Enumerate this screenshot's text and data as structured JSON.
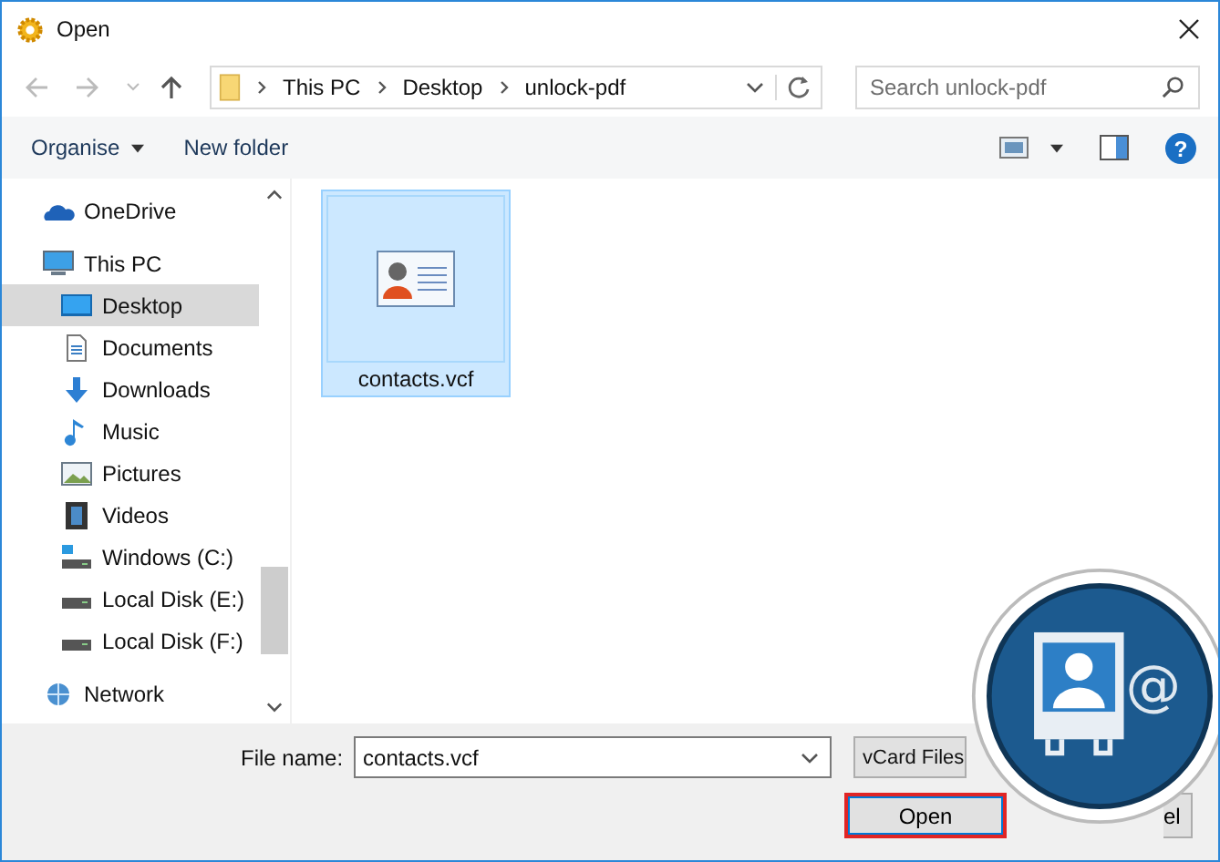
{
  "window": {
    "title": "Open"
  },
  "address": {
    "crumbs": [
      "This PC",
      "Desktop",
      "unlock-pdf"
    ]
  },
  "search": {
    "placeholder": "Search unlock-pdf"
  },
  "toolbar": {
    "organise": "Organise",
    "new_folder": "New folder",
    "help": "?"
  },
  "sidebar": {
    "items": [
      {
        "label": "OneDrive",
        "kind": "cloud",
        "selected": false
      },
      {
        "label": "This PC",
        "kind": "pc",
        "selected": false,
        "children": [
          {
            "label": "Desktop",
            "kind": "desktop",
            "selected": true
          },
          {
            "label": "Documents",
            "kind": "documents",
            "selected": false
          },
          {
            "label": "Downloads",
            "kind": "downloads",
            "selected": false
          },
          {
            "label": "Music",
            "kind": "music",
            "selected": false
          },
          {
            "label": "Pictures",
            "kind": "pictures",
            "selected": false
          },
          {
            "label": "Videos",
            "kind": "videos",
            "selected": false
          },
          {
            "label": "Windows (C:)",
            "kind": "windrive",
            "selected": false
          },
          {
            "label": "Local Disk (E:)",
            "kind": "drive",
            "selected": false
          },
          {
            "label": "Local Disk (F:)",
            "kind": "drive",
            "selected": false
          }
        ]
      },
      {
        "label": "Network",
        "kind": "network",
        "selected": false
      }
    ]
  },
  "files": [
    {
      "name": "contacts.vcf",
      "selected": true
    }
  ],
  "footer": {
    "file_name_label": "File name:",
    "file_name": "contacts.vcf",
    "file_type": "vCard Files",
    "open": "Open",
    "cancel_visible": "el"
  },
  "badge": {
    "symbol": "@"
  }
}
